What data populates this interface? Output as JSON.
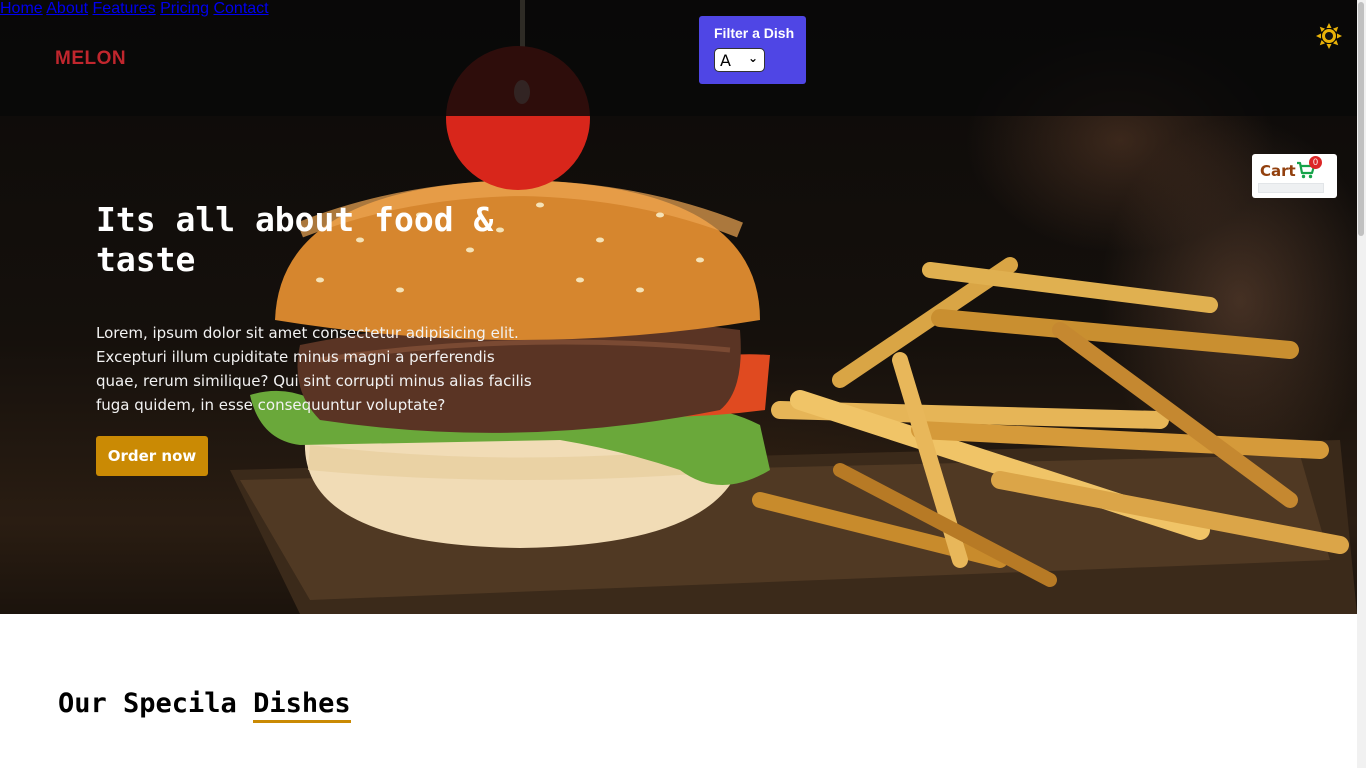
{
  "header": {
    "logo": "MELON",
    "filter": {
      "label": "Filter a Dish",
      "selected": "A"
    },
    "nav": [
      {
        "label": "Home"
      },
      {
        "label": "About"
      },
      {
        "label": "Features"
      },
      {
        "label": "Pricing"
      },
      {
        "label": "Contact"
      }
    ],
    "theme_icon": "sun-icon"
  },
  "hero": {
    "title": "Its all about food & taste",
    "text": "Lorem, ipsum dolor sit amet consectetur adipisicing elit. Excepturi illum cupiditate minus magni a perferendis quae, rerum similique? Qui sint corrupti minus alias facilis fuga quidem, in esse consequuntur voluptate?",
    "cta": "Order now"
  },
  "cart": {
    "label": "Cart",
    "count": "0",
    "icon": "cart-icon"
  },
  "section": {
    "title_part1": "Our Specila ",
    "title_part2": "Dishes"
  },
  "colors": {
    "accent": "#ca8a04",
    "filter_bg": "#4f46e5",
    "logo": "#c0262d",
    "cart_label": "#92400e",
    "badge": "#dc2626"
  }
}
